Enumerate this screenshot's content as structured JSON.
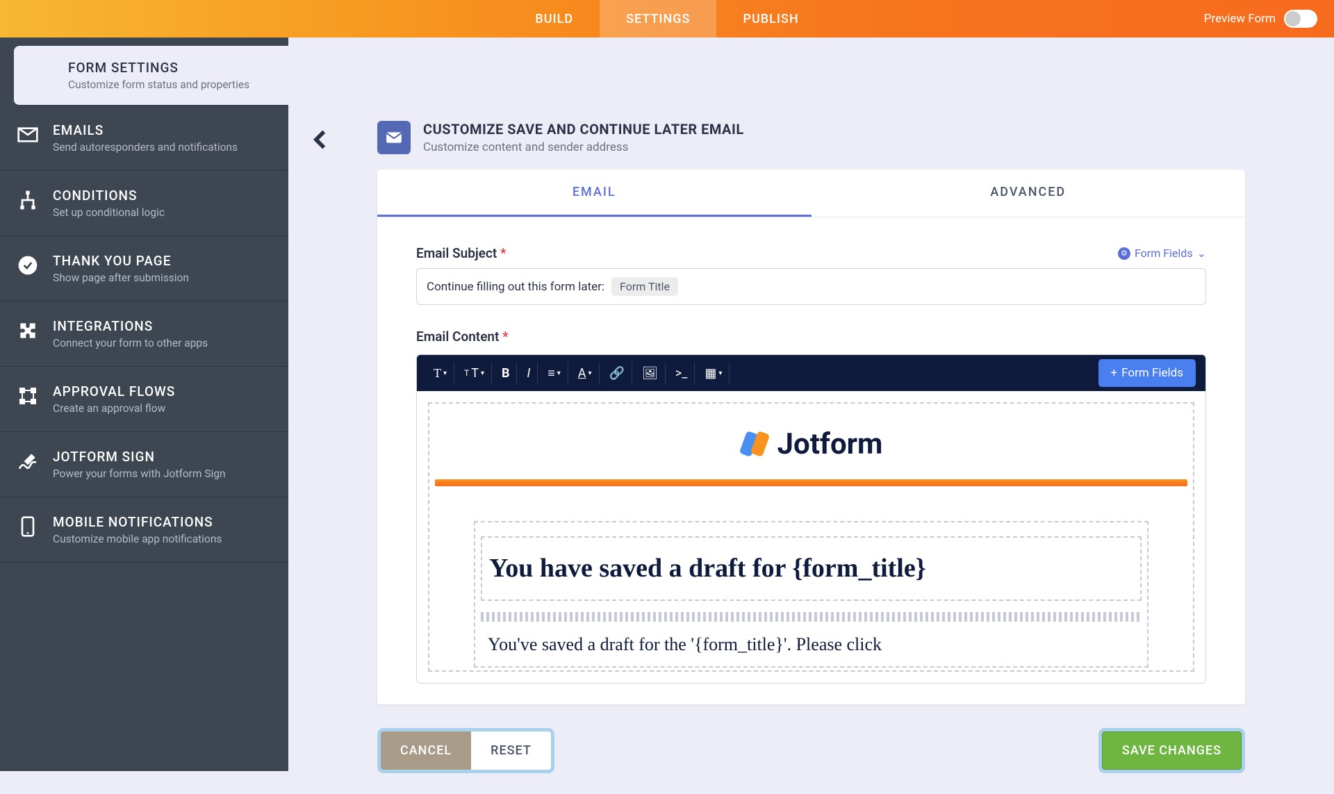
{
  "topbar": {
    "tabs": [
      "BUILD",
      "SETTINGS",
      "PUBLISH"
    ],
    "preview_label": "Preview Form"
  },
  "sidebar": {
    "items": [
      {
        "title": "FORM SETTINGS",
        "sub": "Customize form status and properties"
      },
      {
        "title": "EMAILS",
        "sub": "Send autoresponders and notifications"
      },
      {
        "title": "CONDITIONS",
        "sub": "Set up conditional logic"
      },
      {
        "title": "THANK YOU PAGE",
        "sub": "Show page after submission"
      },
      {
        "title": "INTEGRATIONS",
        "sub": "Connect your form to other apps"
      },
      {
        "title": "APPROVAL FLOWS",
        "sub": "Create an approval flow"
      },
      {
        "title": "JOTFORM SIGN",
        "sub": "Power your forms with Jotform Sign"
      },
      {
        "title": "MOBILE NOTIFICATIONS",
        "sub": "Customize mobile app notifications"
      }
    ]
  },
  "header": {
    "title": "CUSTOMIZE SAVE AND CONTINUE LATER EMAIL",
    "sub": "Customize content and sender address"
  },
  "panel": {
    "tabs": [
      "EMAIL",
      "ADVANCED"
    ],
    "subject_label": "Email Subject",
    "form_fields_link": "Form Fields",
    "subject_text": "Continue filling out this form later:",
    "subject_chip": "Form Title",
    "content_label": "Email Content",
    "ff_button": "Form Fields",
    "logo_text": "Jotform",
    "draft_title": "You have saved a draft for {form_title}",
    "draft_body": "You've saved a draft for the '{form_title}'. Please click"
  },
  "footer": {
    "cancel": "CANCEL",
    "reset": "RESET",
    "save": "SAVE CHANGES"
  }
}
